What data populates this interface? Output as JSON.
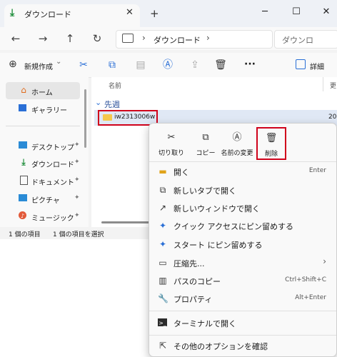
{
  "window": {
    "tab_title": "ダウンロード",
    "tab_close": "✕",
    "new_tab": "+",
    "minimize": "─",
    "maximize": "☐",
    "close": "✕"
  },
  "nav": {
    "back": "←",
    "forward": "→",
    "up": "↑",
    "refresh": "↻",
    "breadcrumb": "ダウンロード",
    "breadcrumb_sep": "›",
    "search_placeholder": "ダウンロ"
  },
  "toolbar": {
    "new_label": "新規作成",
    "new_caret": "⌄",
    "more": "···",
    "details_label": "詳細"
  },
  "sidebar": {
    "items": [
      {
        "label": "ホーム",
        "icon": "home-icon"
      },
      {
        "label": "ギャラリー",
        "icon": "gallery-icon"
      },
      {
        "label": "デスクトップ",
        "icon": "desktop-icon",
        "pin": "📌"
      },
      {
        "label": "ダウンロード",
        "icon": "download-icon",
        "pin": "📌"
      },
      {
        "label": "ドキュメント",
        "icon": "document-icon",
        "pin": "📌"
      },
      {
        "label": "ピクチャ",
        "icon": "pictures-icon",
        "pin": "📌"
      },
      {
        "label": "ミュージック",
        "icon": "music-icon",
        "pin": "📌"
      }
    ]
  },
  "content": {
    "column_name": "名前",
    "column_date": "更",
    "group_label": "先週",
    "file_name": "iw2313006w",
    "file_date": "20"
  },
  "status": {
    "count": "1 個の項目",
    "selected": "1 個の項目を選択"
  },
  "context_menu": {
    "quick_actions": [
      {
        "label": "切り取り",
        "icon": "cut-icon"
      },
      {
        "label": "コピー",
        "icon": "copy-icon"
      },
      {
        "label": "名前の変更",
        "icon": "rename-icon"
      },
      {
        "label": "削除",
        "icon": "delete-icon"
      }
    ],
    "items": [
      {
        "label": "開く",
        "shortcut": "Enter",
        "icon": "folder-open-icon"
      },
      {
        "label": "新しいタブで開く",
        "shortcut": "",
        "icon": "new-tab-icon"
      },
      {
        "label": "新しいウィンドウで開く",
        "shortcut": "",
        "icon": "new-window-icon"
      },
      {
        "label": "クイック アクセスにピン留めする",
        "shortcut": "",
        "icon": "pin-icon"
      },
      {
        "label": "スタート にピン留めする",
        "shortcut": "",
        "icon": "pin-start-icon"
      },
      {
        "label": "圧縮先...",
        "shortcut": "",
        "icon": "archive-icon"
      },
      {
        "label": "パスのコピー",
        "shortcut": "Ctrl+Shift+C",
        "icon": "copy-path-icon"
      },
      {
        "label": "プロパティ",
        "shortcut": "Alt+Enter",
        "icon": "properties-icon"
      },
      {
        "label": "ターミナルで開く",
        "shortcut": "",
        "icon": "terminal-icon"
      },
      {
        "label": "その他のオプションを確認",
        "shortcut": "",
        "icon": "more-options-icon"
      }
    ],
    "submenu_arrow": "›"
  },
  "colors": {
    "highlight": "#d0021b",
    "accent": "#2a6fd6",
    "folder": "#f5c84c"
  }
}
